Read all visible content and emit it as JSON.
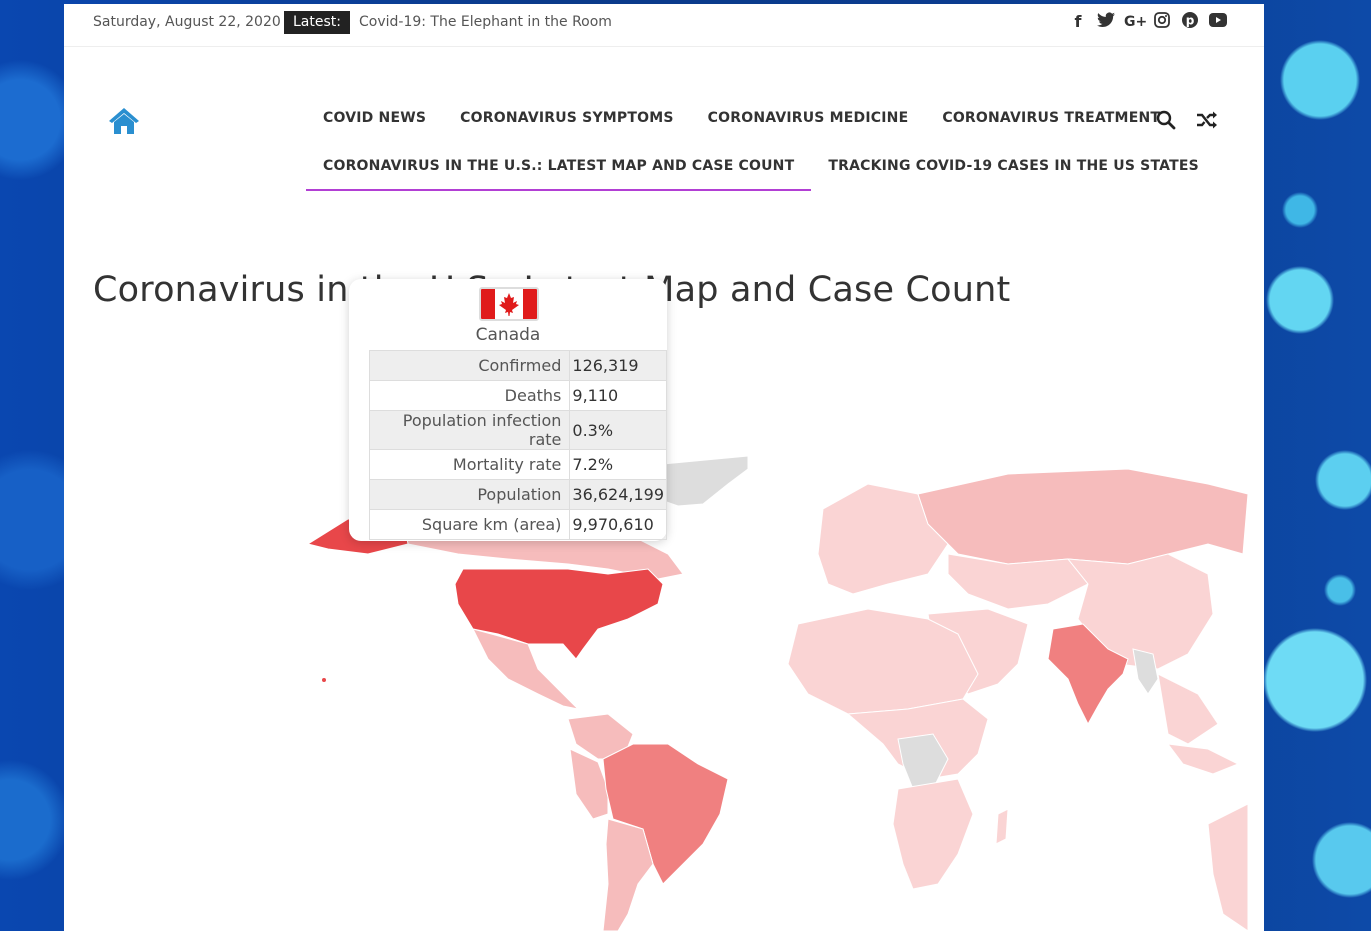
{
  "topbar": {
    "date": "Saturday, August 22, 2020",
    "latest_label": "Latest:",
    "latest_title": "Covid-19: The Elephant in the Room",
    "social_icons": [
      "facebook-icon",
      "twitter-icon",
      "google-plus-icon",
      "instagram-icon",
      "pinterest-icon",
      "youtube-icon"
    ]
  },
  "nav": {
    "row1": [
      "COVID NEWS",
      "CORONAVIRUS SYMPTOMS",
      "CORONAVIRUS MEDICINE",
      "CORONAVIRUS TREATMENT"
    ],
    "row2": [
      "CORONAVIRUS IN THE U.S.: LATEST MAP AND CASE COUNT",
      "TRACKING COVID-19 CASES IN THE US STATES"
    ],
    "active": "CORONAVIRUS IN THE U.S.: LATEST MAP AND CASE COUNT",
    "accent_color": "#b23fd4"
  },
  "page": {
    "title": "Coronavirus in the U.S.: Latest Map and Case Count"
  },
  "tooltip": {
    "country": "Canada",
    "rows": [
      {
        "label": "Confirmed",
        "value": "126,319"
      },
      {
        "label": "Deaths",
        "value": "9,110"
      },
      {
        "label": "Population infection rate",
        "value": "0.3%"
      },
      {
        "label": "Mortality rate",
        "value": "7.2%"
      },
      {
        "label": "Population",
        "value": "36,624,199"
      },
      {
        "label": "Square km (area)",
        "value": "9,970,610"
      }
    ]
  },
  "map": {
    "colors": {
      "high": "#e8474a",
      "medium": "#f08080",
      "low": "#f6bcbc",
      "lowest": "#fad4d4",
      "no_data": "#dddddd"
    }
  }
}
